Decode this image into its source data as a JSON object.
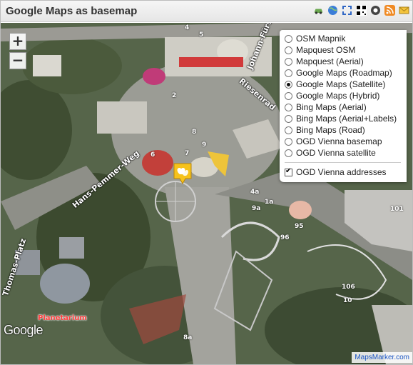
{
  "header": {
    "title": "Google Maps as basemap",
    "toolbar_icons": [
      "car-icon",
      "globe-icon",
      "fullscreen-icon",
      "qr-code-icon",
      "gpx-icon",
      "rss-icon",
      "email-icon"
    ]
  },
  "map": {
    "zoom_in_label": "+",
    "zoom_out_label": "−",
    "street_labels": [
      {
        "name": "street-label-johann-fuerst",
        "text": "Johann-Fürst"
      },
      {
        "name": "street-label-riesenrad",
        "text": "Riesenrad"
      },
      {
        "name": "street-label-hans-pemmer-weg",
        "text": "Hans-Pemmer-Weg"
      },
      {
        "name": "street-label-thomas-platz",
        "text": "Thomas-Platz"
      }
    ],
    "poi_label": "Planetarium",
    "house_numbers": [
      "4",
      "5",
      "2",
      "7",
      "8",
      "9",
      "6",
      "4a",
      "1a",
      "10",
      "95",
      "96",
      "101",
      "106",
      "8a",
      "9a"
    ],
    "attribution_logo": "Google",
    "credit": "MapsMarker.com"
  },
  "layer_switcher": {
    "base_layers": [
      {
        "label": "OSM Mapnik",
        "selected": false
      },
      {
        "label": "Mapquest OSM",
        "selected": false
      },
      {
        "label": "Mapquest (Aerial)",
        "selected": false
      },
      {
        "label": "Google Maps (Roadmap)",
        "selected": false
      },
      {
        "label": "Google Maps (Satellite)",
        "selected": true
      },
      {
        "label": "Google Maps (Hybrid)",
        "selected": false
      },
      {
        "label": "Bing Maps (Aerial)",
        "selected": false
      },
      {
        "label": "Bing Maps (Aerial+Labels)",
        "selected": false
      },
      {
        "label": "Bing Maps (Road)",
        "selected": false
      },
      {
        "label": "OGD Vienna basemap",
        "selected": false
      },
      {
        "label": "OGD Vienna satellite",
        "selected": false
      }
    ],
    "overlays": [
      {
        "label": "OGD Vienna addresses",
        "checked": true
      }
    ]
  },
  "colors": {
    "header_bg": "#ececec",
    "title": "#333333",
    "poi_red": "#ff4040",
    "marker_yellow": "#f6c21b",
    "credit_link": "#1a55c4"
  }
}
